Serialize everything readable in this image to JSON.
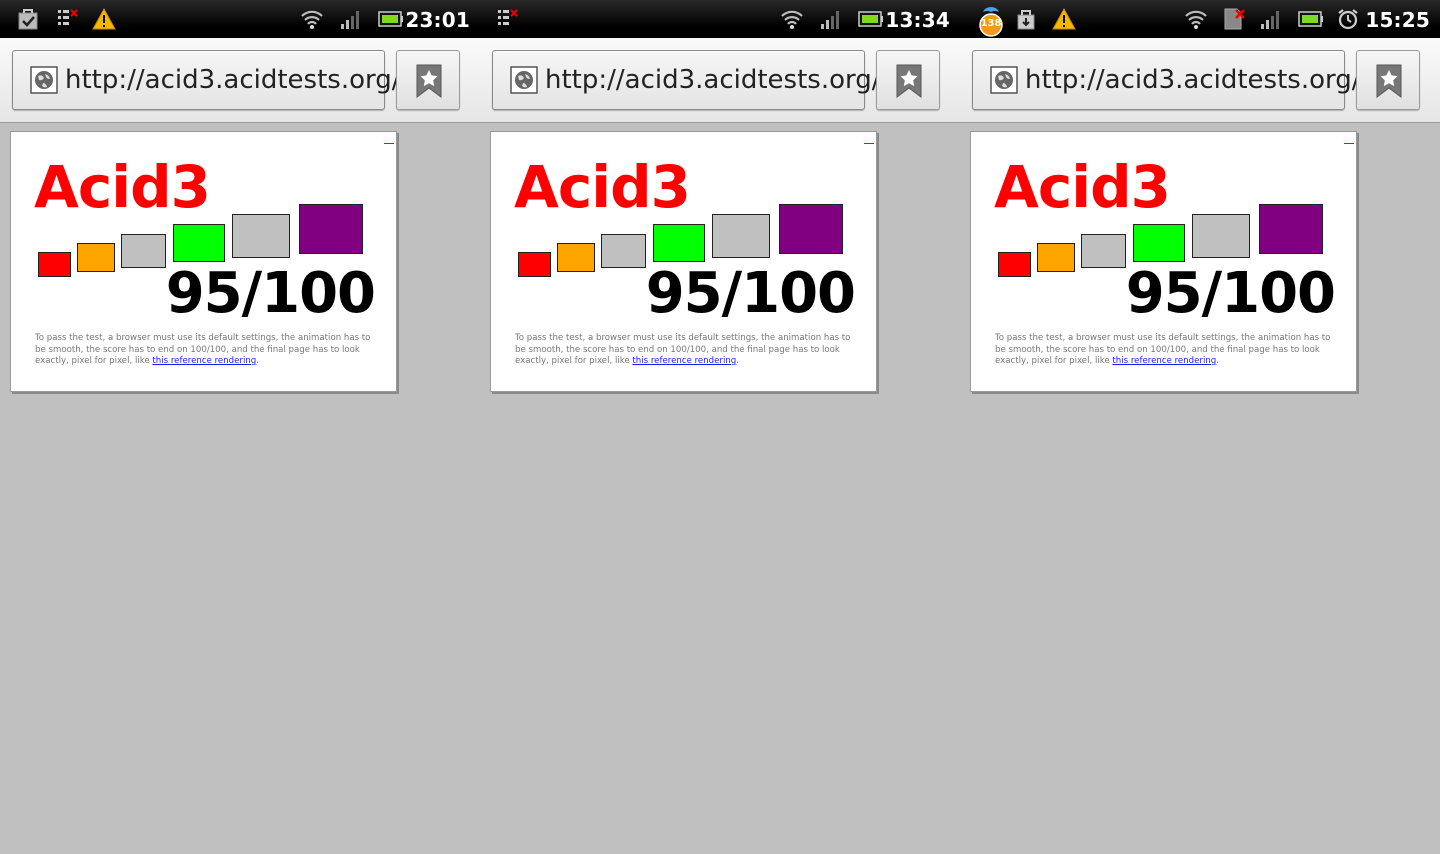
{
  "screenshots": [
    {
      "status": {
        "time": "23:01",
        "left_icons": [
          "shopping-bag-icon",
          "sd-card-error-icon",
          "warning-icon"
        ],
        "right_icons": [
          "wifi-icon",
          "signal-icon",
          "battery-icon"
        ]
      },
      "urlbar": {
        "url": "http://acid3.acidtests.org/"
      },
      "page": {
        "title": "Acid3",
        "score": "95/100",
        "description_prefix": "To pass the test, a browser must use its default settings, the animation has to be smooth, the score has to end on 100/100, and the final page has to look exactly, pixel for pixel, like ",
        "link_text": "this reference rendering",
        "description_suffix": ".",
        "boxes": [
          "#ff0000",
          "#ffa500",
          "#c0c0c0",
          "#00ff00",
          "#c0c0c0",
          "#800080"
        ]
      }
    },
    {
      "status": {
        "time": "13:34",
        "left_icons": [
          "sd-card-error-icon"
        ],
        "right_icons": [
          "wifi-icon",
          "signal-icon",
          "battery-icon"
        ]
      },
      "urlbar": {
        "url": "http://acid3.acidtests.org/"
      },
      "page": {
        "title": "Acid3",
        "score": "95/100",
        "description_prefix": "To pass the test, a browser must use its default settings, the animation has to be smooth, the score has to end on 100/100, and the final page has to look exactly, pixel for pixel, like ",
        "link_text": "this reference rendering",
        "description_suffix": ".",
        "boxes": [
          "#ff0000",
          "#ffa500",
          "#c0c0c0",
          "#00ff00",
          "#c0c0c0",
          "#800080"
        ]
      }
    },
    {
      "status": {
        "time": "15:25",
        "badge_count": "138",
        "left_icons": [
          "notification-badge-icon",
          "download-icon",
          "warning-icon"
        ],
        "right_icons": [
          "wifi-icon",
          "no-sim-icon",
          "signal-icon",
          "battery-icon",
          "alarm-icon"
        ]
      },
      "urlbar": {
        "url": "http://acid3.acidtests.org/"
      },
      "page": {
        "title": "Acid3",
        "score": "95/100",
        "description_prefix": "To pass the test, a browser must use its default settings, the animation has to be smooth, the score has to end on 100/100, and the final page has to look exactly, pixel for pixel, like ",
        "link_text": "this reference rendering",
        "description_suffix": ".",
        "boxes": [
          "#ff0000",
          "#ffa500",
          "#c0c0c0",
          "#00ff00",
          "#c0c0c0",
          "#800080"
        ]
      }
    }
  ]
}
